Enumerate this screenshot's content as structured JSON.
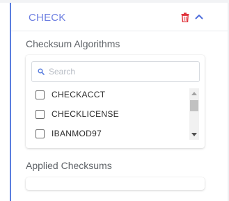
{
  "panel": {
    "title": "CHECK",
    "icons": {
      "delete": "trash-icon",
      "collapse": "chevron-up-icon"
    },
    "colors": {
      "accent": "#5b7fdf",
      "title": "#6c7ee1",
      "delete": "#e0323a"
    }
  },
  "checksum_algorithms": {
    "label": "Checksum Algorithms",
    "search": {
      "placeholder": "Search",
      "value": "",
      "icon": "search-icon"
    },
    "items": [
      {
        "label": "CHECKACCT",
        "checked": false
      },
      {
        "label": "CHECKLICENSE",
        "checked": false
      },
      {
        "label": "IBANMOD97",
        "checked": false
      }
    ],
    "scroll_fraction": 0.0
  },
  "applied_checksums": {
    "label": "Applied Checksums",
    "items": []
  }
}
